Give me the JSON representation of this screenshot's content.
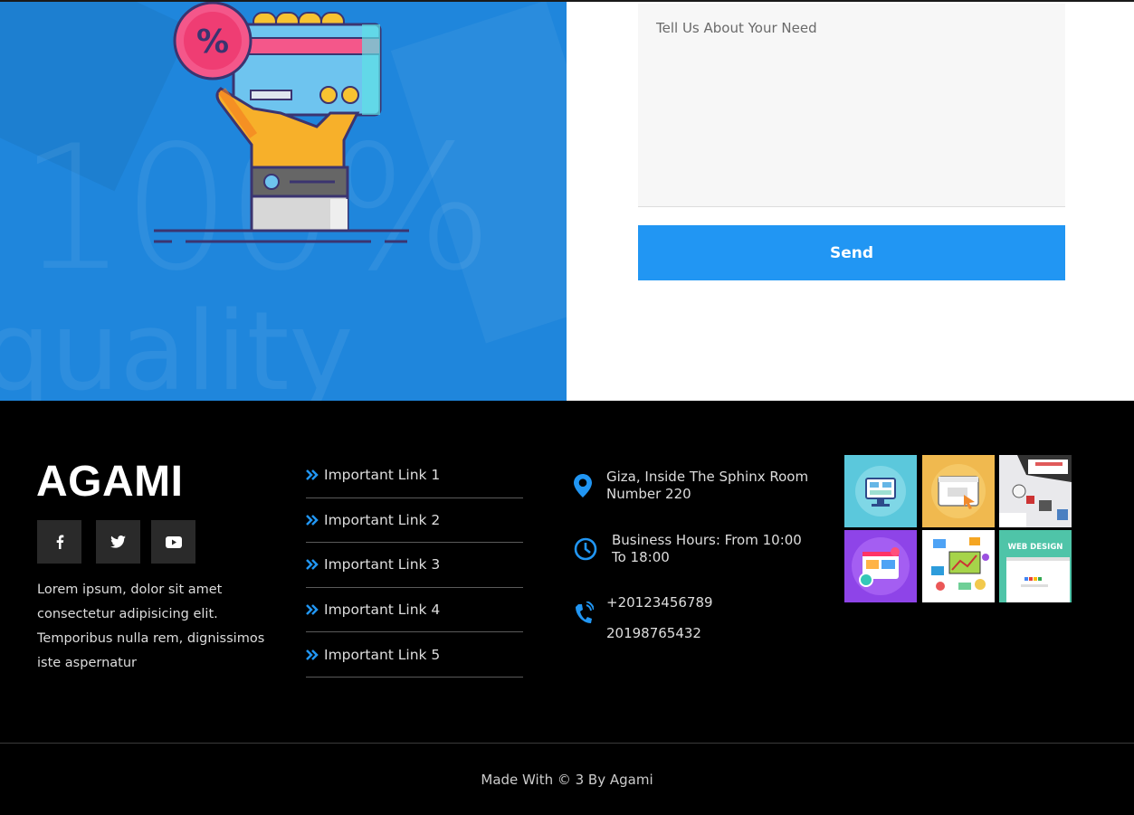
{
  "form": {
    "message_placeholder": "Tell Us About Your Need",
    "send_label": "Send"
  },
  "footer": {
    "brand": "AGAMI",
    "social": [
      {
        "icon": "facebook-icon"
      },
      {
        "icon": "twitter-icon"
      },
      {
        "icon": "youtube-icon"
      }
    ],
    "about_text": "Lorem ipsum, dolor sit amet consectetur adipisicing elit. Temporibus nulla rem, dignissimos iste aspernatur",
    "links": [
      "Important Link 1",
      "Important Link 2",
      "Important Link 3",
      "Important Link 4",
      "Important Link 5"
    ],
    "contact": {
      "address": "Giza, Inside The Sphinx Room Number 220",
      "hours": "Business Hours: From 10:00 To 18:00",
      "phone1": "+20123456789",
      "phone2": "20198765432"
    },
    "gallery_tile_text": "WEB DESIGN",
    "copyright": "Made With © 3 By Agami"
  },
  "colors": {
    "accent": "#2196f3",
    "hero_bg": "#1f86dc",
    "footer_bg": "#000000"
  }
}
